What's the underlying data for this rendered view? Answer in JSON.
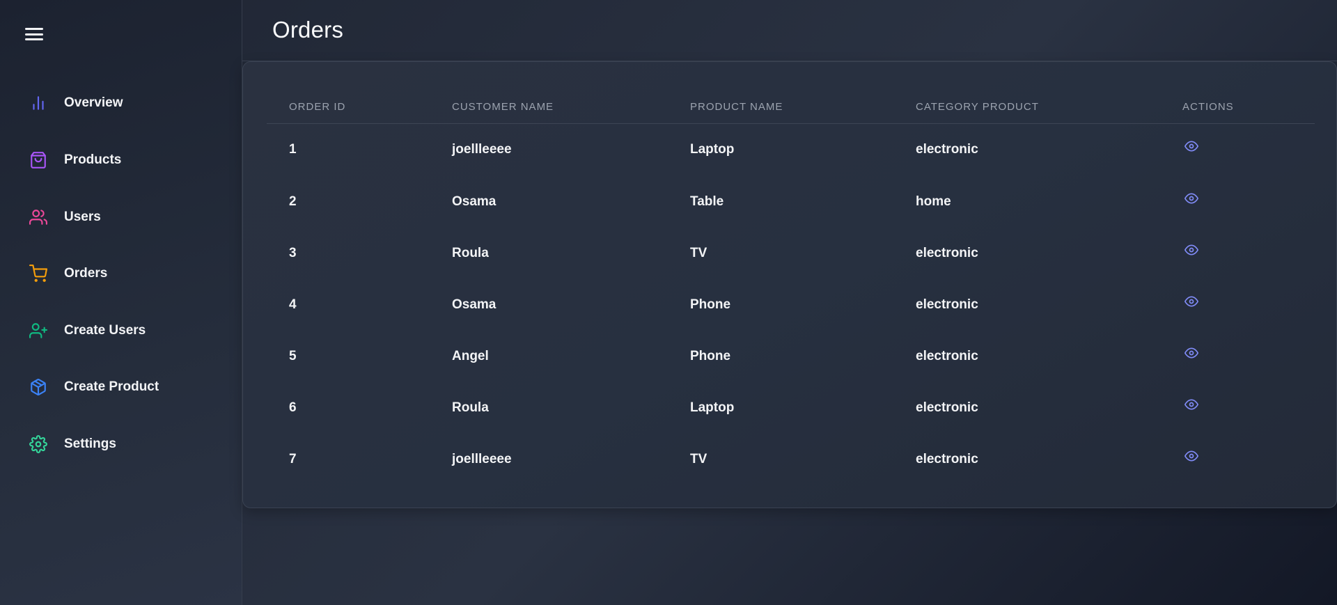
{
  "colors": {
    "overview": "#6366f1",
    "products": "#a855f7",
    "users": "#ec4899",
    "orders": "#f59e0b",
    "create_users": "#10b981",
    "create_product": "#3b82f6",
    "settings": "#34d399",
    "eye": "#818cf8"
  },
  "sidebar": {
    "items": [
      {
        "label": "Overview",
        "icon": "bar-chart-icon"
      },
      {
        "label": "Products",
        "icon": "shopping-bag-icon"
      },
      {
        "label": "Users",
        "icon": "users-icon"
      },
      {
        "label": "Orders",
        "icon": "shopping-cart-icon"
      },
      {
        "label": "Create Users",
        "icon": "user-plus-icon"
      },
      {
        "label": "Create Product",
        "icon": "package-icon"
      },
      {
        "label": "Settings",
        "icon": "settings-icon"
      }
    ]
  },
  "header": {
    "title": "Orders"
  },
  "table": {
    "columns": [
      "ORDER ID",
      "CUSTOMER NAME",
      "PRODUCT NAME",
      "CATEGORY PRODUCT",
      "ACTIONS"
    ],
    "rows": [
      {
        "id": "1",
        "customer": "joellleeee",
        "product": "Laptop",
        "category": "electronic"
      },
      {
        "id": "2",
        "customer": "Osama",
        "product": "Table",
        "category": "home"
      },
      {
        "id": "3",
        "customer": "Roula",
        "product": "TV",
        "category": "electronic"
      },
      {
        "id": "4",
        "customer": "Osama",
        "product": "Phone",
        "category": "electronic"
      },
      {
        "id": "5",
        "customer": "Angel",
        "product": "Phone",
        "category": "electronic"
      },
      {
        "id": "6",
        "customer": "Roula",
        "product": "Laptop",
        "category": "electronic"
      },
      {
        "id": "7",
        "customer": "joellleeee",
        "product": "TV",
        "category": "electronic"
      }
    ],
    "action_icon": "eye-icon"
  }
}
